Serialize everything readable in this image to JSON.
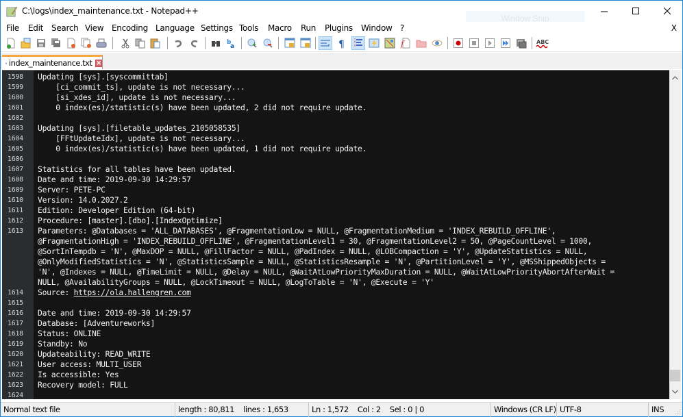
{
  "window": {
    "title": "C:\\logs\\index_maintenance.txt - Notepad++",
    "overlay_label": "Window Snip",
    "controls": [
      "minimize",
      "maximize",
      "close"
    ]
  },
  "menu": {
    "items": [
      "File",
      "Edit",
      "Search",
      "View",
      "Encoding",
      "Language",
      "Settings",
      "Tools",
      "Macro",
      "Run",
      "Plugins",
      "Window",
      "?"
    ],
    "close_doc": "X"
  },
  "toolbar": {
    "buttons": [
      {
        "icon": "new-file-icon"
      },
      {
        "icon": "open-file-icon"
      },
      {
        "icon": "save-icon"
      },
      {
        "icon": "save-all-icon"
      },
      {
        "icon": "close-icon"
      },
      {
        "icon": "close-all-icon"
      },
      {
        "icon": "print-icon"
      },
      {
        "icon": "cut-icon"
      },
      {
        "icon": "copy-icon"
      },
      {
        "icon": "paste-icon"
      },
      {
        "icon": "undo-icon"
      },
      {
        "icon": "redo-icon"
      },
      {
        "icon": "find-icon"
      },
      {
        "icon": "replace-icon"
      },
      {
        "icon": "zoom-in-icon"
      },
      {
        "icon": "zoom-out-icon"
      },
      {
        "icon": "sync-vertical-icon"
      },
      {
        "icon": "sync-horizontal-icon"
      },
      {
        "icon": "word-wrap-icon",
        "active": true
      },
      {
        "icon": "show-all-chars-icon"
      },
      {
        "icon": "indent-guide-icon",
        "active": true
      },
      {
        "icon": "user-language-icon"
      },
      {
        "icon": "document-map-icon"
      },
      {
        "icon": "function-list-icon"
      },
      {
        "icon": "folder-workspace-icon"
      },
      {
        "icon": "monitoring-icon"
      },
      {
        "icon": "record-macro-icon"
      },
      {
        "icon": "stop-record-icon"
      },
      {
        "icon": "play-macro-icon"
      },
      {
        "icon": "run-macro-multiple-icon"
      },
      {
        "icon": "save-macro-icon"
      },
      {
        "icon": "spell-check-icon"
      }
    ]
  },
  "tab": {
    "label": "index_maintenance.txt",
    "close": "✕"
  },
  "editor": {
    "lines": [
      {
        "n": "1598",
        "text": "Updating [sys].[syscommittab]"
      },
      {
        "n": "1599",
        "text": "    [ci_commit_ts], update is not necessary..."
      },
      {
        "n": "1600",
        "text": "    [si_xdes_id], update is not necessary..."
      },
      {
        "n": "1601",
        "text": "    0 index(es)/statistic(s) have been updated, 2 did not require update."
      },
      {
        "n": "1602",
        "text": ""
      },
      {
        "n": "1603",
        "text": "Updating [sys].[filetable_updates_2105058535]"
      },
      {
        "n": "1604",
        "text": "    [FFtUpdateIdx], update is not necessary..."
      },
      {
        "n": "1605",
        "text": "    0 index(es)/statistic(s) have been updated, 1 did not require update."
      },
      {
        "n": "1606",
        "text": ""
      },
      {
        "n": "1607",
        "text": "Statistics for all tables have been updated."
      },
      {
        "n": "1608",
        "text": "Date and time: 2019-09-30 14:29:57"
      },
      {
        "n": "1609",
        "text": "Server: PETE-PC"
      },
      {
        "n": "1610",
        "text": "Version: 14.0.2027.2"
      },
      {
        "n": "1611",
        "text": "Edition: Developer Edition (64-bit)"
      },
      {
        "n": "1612",
        "text": "Procedure: [master].[dbo].[IndexOptimize]"
      },
      {
        "n": "1613",
        "text": "Parameters: @Databases = 'ALL_DATABASES', @FragmentationLow = NULL, @FragmentationMedium = 'INDEX_REBUILD_OFFLINE',"
      },
      {
        "n": "",
        "text": "@FragmentationHigh = 'INDEX_REBUILD_OFFLINE', @FragmentationLevel1 = 30, @FragmentationLevel2 = 50, @PageCountLevel = 1000,"
      },
      {
        "n": "",
        "text": "@SortInTempdb = 'N', @MaxDOP = NULL, @FillFactor = NULL, @PadIndex = NULL, @LOBCompaction = 'Y', @UpdateStatistics = NULL,"
      },
      {
        "n": "",
        "text": "@OnlyModifiedStatistics = 'N', @StatisticsSample = NULL, @StatisticsResample = 'N', @PartitionLevel = 'Y', @MSShippedObjects ="
      },
      {
        "n": "",
        "text": "'N', @Indexes = NULL, @TimeLimit = NULL, @Delay = NULL, @WaitAtLowPriorityMaxDuration = NULL, @WaitAtLowPriorityAbortAfterWait ="
      },
      {
        "n": "",
        "text": "NULL, @AvailabilityGroups = NULL, @LockTimeout = NULL, @LogToTable = 'N', @Execute = 'Y'"
      },
      {
        "n": "1614",
        "text": "Source: ",
        "link": "https://ola.hallengren.com"
      },
      {
        "n": "1615",
        "text": ""
      },
      {
        "n": "1616",
        "text": "Date and time: 2019-09-30 14:29:57"
      },
      {
        "n": "1617",
        "text": "Database: [Adventureworks]"
      },
      {
        "n": "1618",
        "text": "Status: ONLINE"
      },
      {
        "n": "1619",
        "text": "Standby: No"
      },
      {
        "n": "1620",
        "text": "Updateability: READ_WRITE"
      },
      {
        "n": "1621",
        "text": "User access: MULTI_USER"
      },
      {
        "n": "1622",
        "text": "Is accessible: Yes"
      },
      {
        "n": "1623",
        "text": "Recovery model: FULL"
      },
      {
        "n": "1624",
        "text": ""
      }
    ]
  },
  "statusbar": {
    "file_type": "Normal text file",
    "length_lines": "length : 80,811    lines : 1,653",
    "position": "Ln : 1,572    Col : 2    Sel : 0 | 0",
    "eol": "Windows (CR LF)",
    "encoding": "UTF-8",
    "mode": "INS"
  },
  "colors": {
    "editor_bg": "#141414",
    "gutter_bg": "#2a2d30",
    "tab_accent": "#faa73f",
    "window_border": "#1883d7"
  }
}
